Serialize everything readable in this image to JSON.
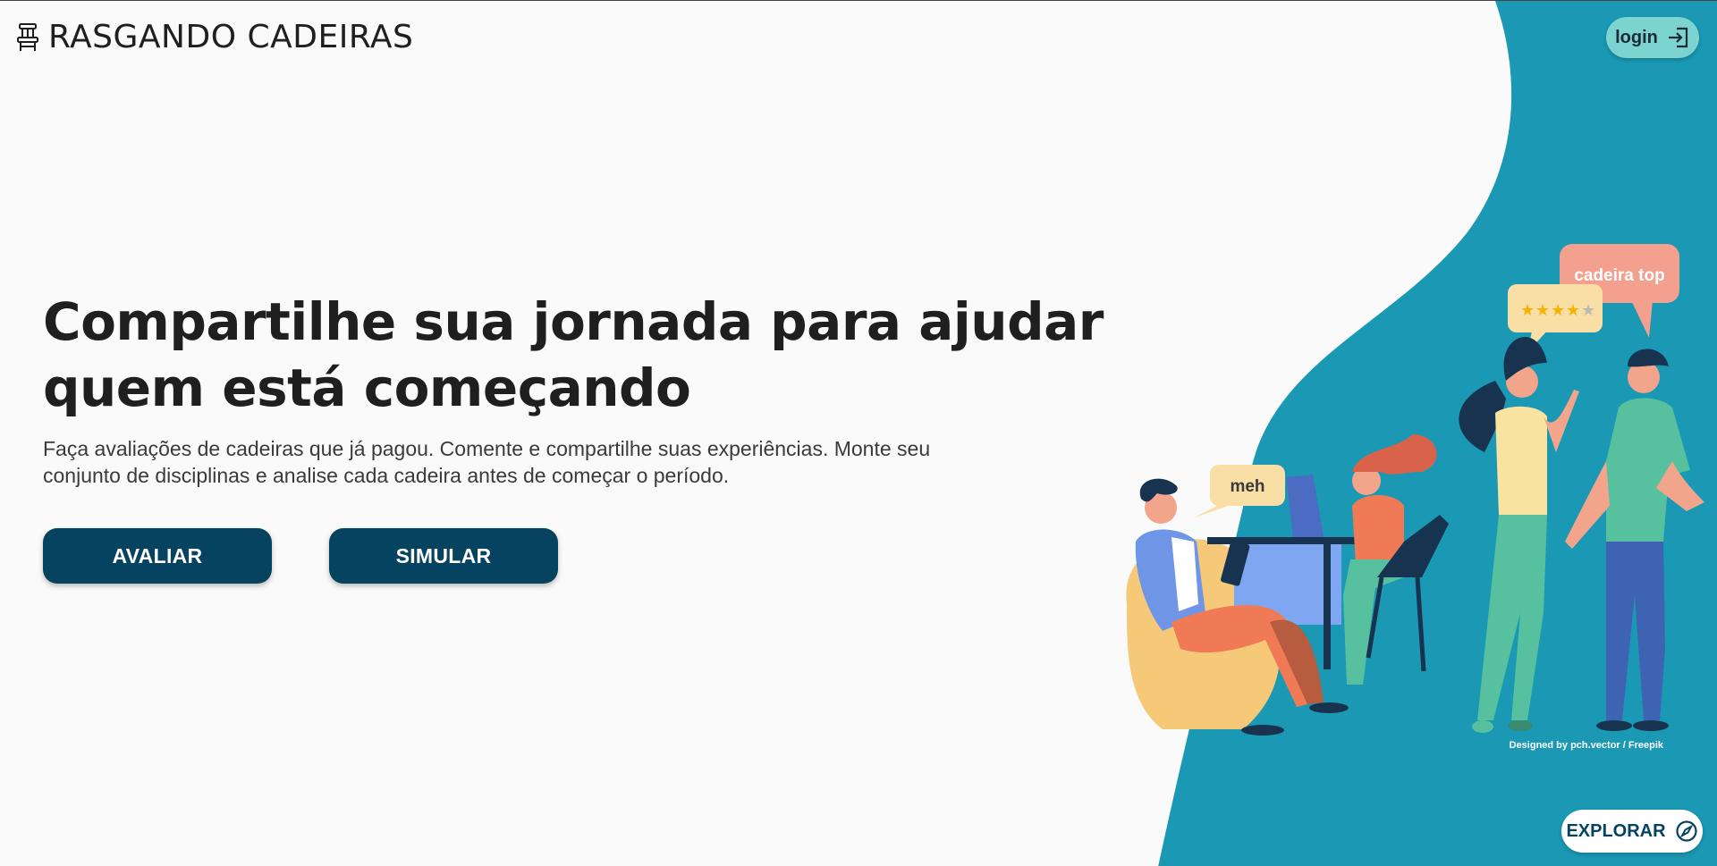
{
  "header": {
    "brand_title": "RASGANDO CADEIRAS",
    "brand_icon": "chair-icon",
    "login_label": "login",
    "login_icon": "login-icon"
  },
  "hero": {
    "headline": "Compartilhe sua jornada para ajudar quem está começando",
    "description": "Faça avaliações de cadeiras que já pagou. Comente e compartilhe suas experiências. Monte seu conjunto de disciplinas e analise cada cadeira antes de começar o período.",
    "buttons": {
      "evaluate_label": "AVALIAR",
      "simulate_label": "SIMULAR"
    }
  },
  "illustration": {
    "bubble_meh": "meh",
    "bubble_top": "cadeira top",
    "rating_stars": 4,
    "rating_max": 5,
    "credit": "Designed by pch.vector / Freepik"
  },
  "footer": {
    "explore_label": "EXPLORAR",
    "explore_icon": "compass-icon"
  },
  "colors": {
    "background": "#fafafa",
    "wave": "#1a98b4",
    "primary_button": "#064360",
    "login_button": "#7dd3cf",
    "text": "#1f1f1f"
  }
}
